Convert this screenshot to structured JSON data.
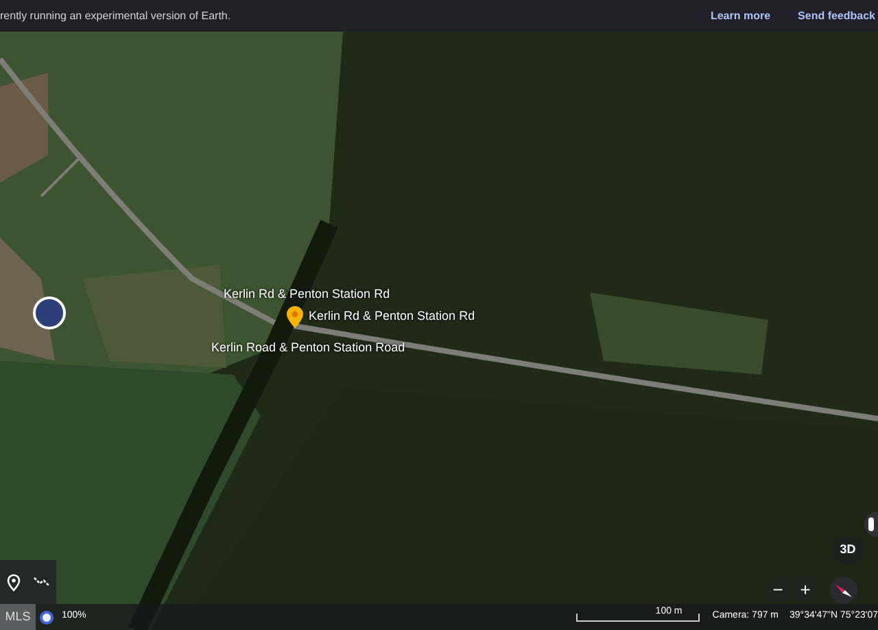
{
  "banner": {
    "message": "rently running an experimental version of Earth.",
    "links": [
      "Learn more",
      "Send feedback"
    ]
  },
  "map": {
    "labels": [
      {
        "text": "Kerlin Rd & Penton Station Rd",
        "kind": "plain"
      },
      {
        "text": "Kerlin Rd & Penton Station Rd",
        "kind": "pin"
      },
      {
        "text": "Kerlin Road & Penton Station Road",
        "kind": "plain"
      }
    ]
  },
  "controls": {
    "view_button": "3D",
    "zoom_out": "−",
    "zoom_in": "+"
  },
  "status_bar": {
    "mls": "MLS",
    "progress": {
      "text": "100%",
      "level": 1
    },
    "scale": "100 m",
    "camera": "Camera: 797 m",
    "coordinates": "39°34'47\"N 75°23'07"
  }
}
